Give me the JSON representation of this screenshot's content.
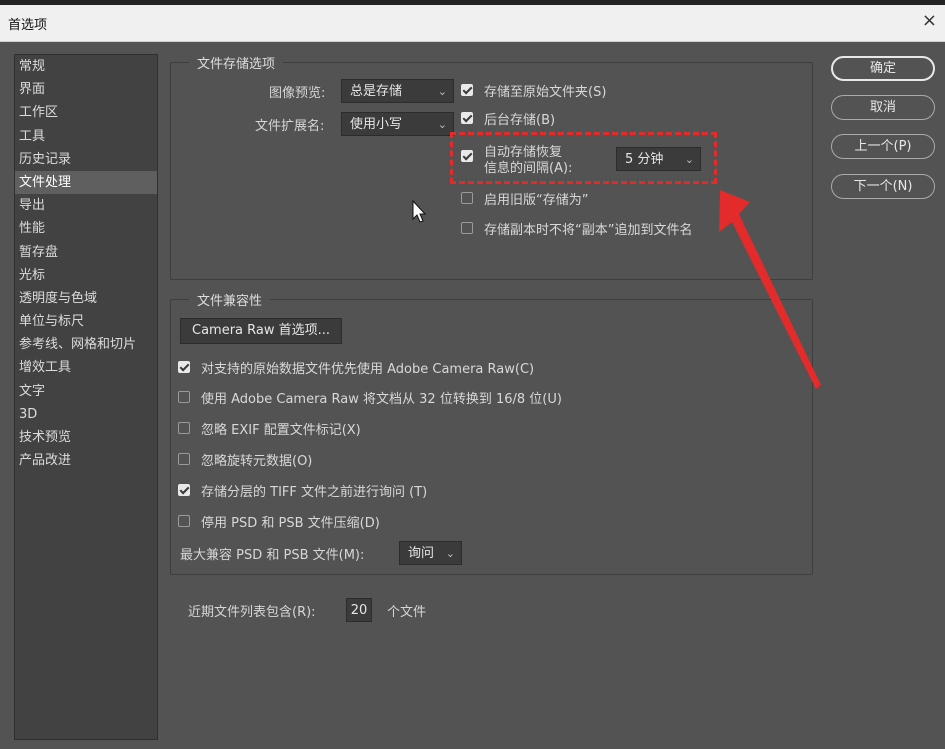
{
  "window": {
    "title": "首选项",
    "close_glyph": "×"
  },
  "sidebar": {
    "items": [
      {
        "label": "常规"
      },
      {
        "label": "界面"
      },
      {
        "label": "工作区"
      },
      {
        "label": "工具"
      },
      {
        "label": "历史记录"
      },
      {
        "label": "文件处理"
      },
      {
        "label": "导出"
      },
      {
        "label": "性能"
      },
      {
        "label": "暂存盘"
      },
      {
        "label": "光标"
      },
      {
        "label": "透明度与色域"
      },
      {
        "label": "单位与标尺"
      },
      {
        "label": "参考线、网格和切片"
      },
      {
        "label": "增效工具"
      },
      {
        "label": "文字"
      },
      {
        "label": "3D"
      },
      {
        "label": "技术预览"
      },
      {
        "label": "产品改进"
      }
    ],
    "selected": "文件处理"
  },
  "file_saving": {
    "title": "文件存储选项",
    "image_preview_label": "图像预览:",
    "image_preview_value": "总是存储",
    "extension_label": "文件扩展名:",
    "extension_value": "使用小写",
    "save_to_original": {
      "label": "存储至原始文件夹(S)",
      "checked": true
    },
    "background_save": {
      "label": "后台存储(B)",
      "checked": true
    },
    "autosave": {
      "label_line1": "自动存储恢复",
      "label_line2": "信息的间隔(A):",
      "checked": true,
      "interval": "5 分钟"
    },
    "legacy_save_as": {
      "label": "启用旧版“存储为”",
      "checked": false
    },
    "no_copy_suffix": {
      "label": "存储副本时不将“副本”追加到文件名",
      "checked": false
    }
  },
  "compatibility": {
    "title": "文件兼容性",
    "camera_raw_button": "Camera Raw 首选项...",
    "options": [
      {
        "label": "对支持的原始数据文件优先使用 Adobe Camera Raw(C)",
        "checked": true
      },
      {
        "label": "使用 Adobe Camera Raw 将文档从 32 位转换到 16/8 位(U)",
        "checked": false
      },
      {
        "label": "忽略 EXIF 配置文件标记(X)",
        "checked": false
      },
      {
        "label": "忽略旋转元数据(O)",
        "checked": false
      },
      {
        "label": "存储分层的 TIFF 文件之前进行询问 (T)",
        "checked": true
      },
      {
        "label": "停用 PSD 和 PSB 文件压缩(D)",
        "checked": false
      }
    ],
    "max_compat_label": "最大兼容 PSD 和 PSB 文件(M):",
    "max_compat_value": "询问"
  },
  "recent": {
    "label": "近期文件列表包含(R):",
    "value": "20",
    "suffix": "个文件"
  },
  "buttons": {
    "ok": "确定",
    "cancel": "取消",
    "prev": "上一个(P)",
    "next": "下一个(N)"
  },
  "icons": {
    "chevron": "⌄"
  },
  "colors": {
    "annotation": "#e32b2b"
  }
}
